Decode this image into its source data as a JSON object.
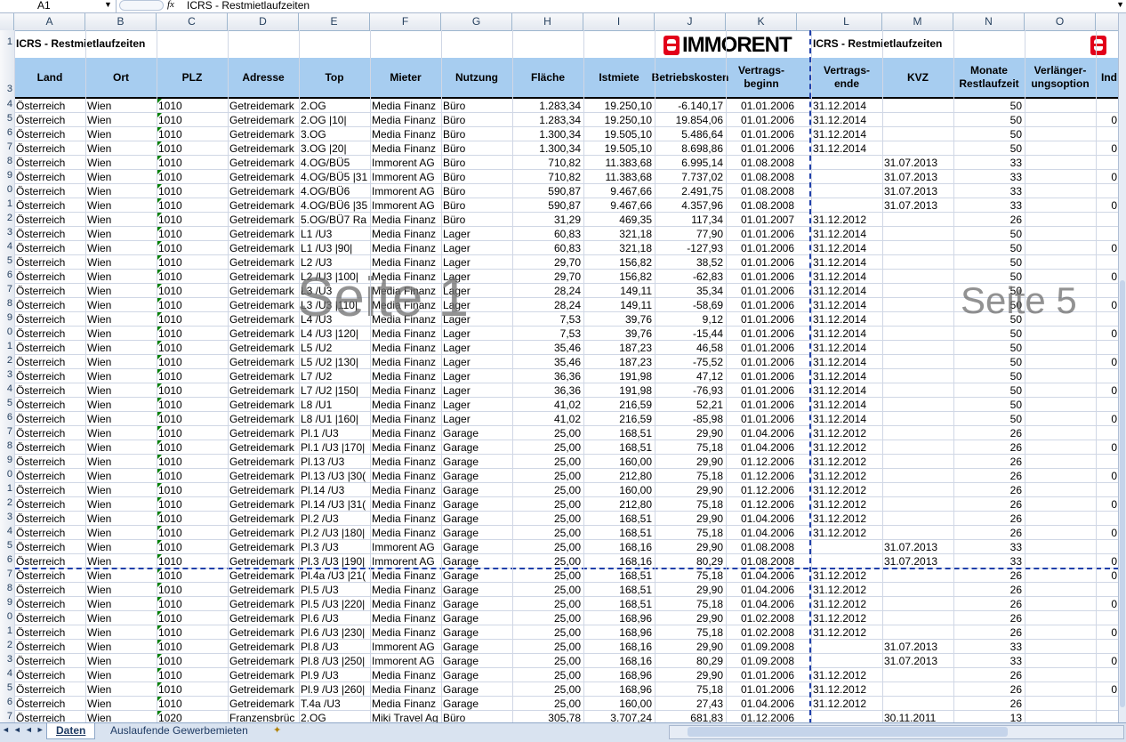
{
  "formula_bar": {
    "cell_ref": "A1",
    "fx": "fx",
    "content": "ICRS - Restmietlaufzeiten"
  },
  "columns": [
    "A",
    "B",
    "C",
    "D",
    "E",
    "F",
    "G",
    "H",
    "I",
    "J",
    "K",
    "L",
    "M",
    "N",
    "O"
  ],
  "row_numbers": [
    "1",
    "3",
    "4",
    "5",
    "6",
    "7",
    "8",
    "9",
    "0",
    "1",
    "2",
    "3",
    "4",
    "5",
    "6",
    "7",
    "8",
    "9",
    "0",
    "1",
    "2",
    "3",
    "4",
    "5",
    "6",
    "7",
    "8",
    "9",
    "0",
    "1",
    "2",
    "3",
    "4",
    "5",
    "6",
    "7",
    "8",
    "9",
    "0",
    "1",
    "2",
    "3",
    "4",
    "5",
    "6",
    "7"
  ],
  "title": "ICRS - Restmietlaufzeiten",
  "title2": "ICRS - Restmietlaufzeiten",
  "logo_text": "IMMORENT",
  "headers": {
    "land": "Land",
    "ort": "Ort",
    "plz": "PLZ",
    "adresse": "Adresse",
    "top": "Top",
    "mieter": "Mieter",
    "nutzung": "Nutzung",
    "flaeche": "Fläche",
    "istmiete": "Istmiete",
    "betriebskosten": "Betriebskosten",
    "vertragsbeginn": "Vertrags-\nbeginn",
    "vertragsende": "Vertrags-\nende",
    "kvz": "KVZ",
    "restlaufzeit": "Monate\nRestlaufzeit",
    "verlaengerung": "Verlänger-\nungsoption",
    "ind": "Ind"
  },
  "rows": [
    [
      "Österreich",
      "Wien",
      "1010",
      "Getreidemark",
      "2.OG",
      "Media Finanz",
      "Büro",
      "1.283,34",
      "19.250,10",
      "-6.140,17",
      "01.01.2006",
      "31.12.2014",
      "",
      "50",
      ""
    ],
    [
      "Österreich",
      "Wien",
      "1010",
      "Getreidemark",
      "2.OG |10|",
      "Media Finanz",
      "Büro",
      "1.283,34",
      "19.250,10",
      "19.854,06",
      "01.01.2006",
      "31.12.2014",
      "",
      "50",
      "0"
    ],
    [
      "Österreich",
      "Wien",
      "1010",
      "Getreidemark",
      "3.OG",
      "Media Finanz",
      "Büro",
      "1.300,34",
      "19.505,10",
      "5.486,64",
      "01.01.2006",
      "31.12.2014",
      "",
      "50",
      ""
    ],
    [
      "Österreich",
      "Wien",
      "1010",
      "Getreidemark",
      "3.OG |20|",
      "Media Finanz",
      "Büro",
      "1.300,34",
      "19.505,10",
      "8.698,86",
      "01.01.2006",
      "31.12.2014",
      "",
      "50",
      "0"
    ],
    [
      "Österreich",
      "Wien",
      "1010",
      "Getreidemark",
      "4.OG/BÜ5",
      "Immorent AG",
      "Büro",
      "710,82",
      "11.383,68",
      "6.995,14",
      "01.08.2008",
      "",
      "31.07.2013",
      "33",
      ""
    ],
    [
      "Österreich",
      "Wien",
      "1010",
      "Getreidemark",
      "4.OG/BÜ5 |31",
      "Immorent AG",
      "Büro",
      "710,82",
      "11.383,68",
      "7.737,02",
      "01.08.2008",
      "",
      "31.07.2013",
      "33",
      "0"
    ],
    [
      "Österreich",
      "Wien",
      "1010",
      "Getreidemark",
      "4.OG/BÜ6",
      "Immorent AG",
      "Büro",
      "590,87",
      "9.467,66",
      "2.491,75",
      "01.08.2008",
      "",
      "31.07.2013",
      "33",
      ""
    ],
    [
      "Österreich",
      "Wien",
      "1010",
      "Getreidemark",
      "4.OG/BÜ6 |35",
      "Immorent AG",
      "Büro",
      "590,87",
      "9.467,66",
      "4.357,96",
      "01.08.2008",
      "",
      "31.07.2013",
      "33",
      "0"
    ],
    [
      "Österreich",
      "Wien",
      "1010",
      "Getreidemark",
      "5.OG/BÜ7 Ra",
      "Media Finanz",
      "Büro",
      "31,29",
      "469,35",
      "117,34",
      "01.01.2007",
      "31.12.2012",
      "",
      "26",
      ""
    ],
    [
      "Österreich",
      "Wien",
      "1010",
      "Getreidemark",
      "L1 /U3",
      "Media Finanz",
      "Lager",
      "60,83",
      "321,18",
      "77,90",
      "01.01.2006",
      "31.12.2014",
      "",
      "50",
      ""
    ],
    [
      "Österreich",
      "Wien",
      "1010",
      "Getreidemark",
      "L1 /U3 |90|",
      "Media Finanz",
      "Lager",
      "60,83",
      "321,18",
      "-127,93",
      "01.01.2006",
      "31.12.2014",
      "",
      "50",
      "0"
    ],
    [
      "Österreich",
      "Wien",
      "1010",
      "Getreidemark",
      "L2 /U3",
      "Media Finanz",
      "Lager",
      "29,70",
      "156,82",
      "38,52",
      "01.01.2006",
      "31.12.2014",
      "",
      "50",
      ""
    ],
    [
      "Österreich",
      "Wien",
      "1010",
      "Getreidemark",
      "L2 /U3 |100|",
      "Media Finanz",
      "Lager",
      "29,70",
      "156,82",
      "-62,83",
      "01.01.2006",
      "31.12.2014",
      "",
      "50",
      "0"
    ],
    [
      "Österreich",
      "Wien",
      "1010",
      "Getreidemark",
      "L3 /U3",
      "Media Finanz",
      "Lager",
      "28,24",
      "149,11",
      "35,34",
      "01.01.2006",
      "31.12.2014",
      "",
      "50",
      ""
    ],
    [
      "Österreich",
      "Wien",
      "1010",
      "Getreidemark",
      "L3 /U3 |110|",
      "Media Finanz",
      "Lager",
      "28,24",
      "149,11",
      "-58,69",
      "01.01.2006",
      "31.12.2014",
      "",
      "50",
      "0"
    ],
    [
      "Österreich",
      "Wien",
      "1010",
      "Getreidemark",
      "L4 /U3",
      "Media Finanz",
      "Lager",
      "7,53",
      "39,76",
      "9,12",
      "01.01.2006",
      "31.12.2014",
      "",
      "50",
      ""
    ],
    [
      "Österreich",
      "Wien",
      "1010",
      "Getreidemark",
      "L4 /U3 |120|",
      "Media Finanz",
      "Lager",
      "7,53",
      "39,76",
      "-15,44",
      "01.01.2006",
      "31.12.2014",
      "",
      "50",
      "0"
    ],
    [
      "Österreich",
      "Wien",
      "1010",
      "Getreidemark",
      "L5 /U2",
      "Media Finanz",
      "Lager",
      "35,46",
      "187,23",
      "46,58",
      "01.01.2006",
      "31.12.2014",
      "",
      "50",
      ""
    ],
    [
      "Österreich",
      "Wien",
      "1010",
      "Getreidemark",
      "L5 /U2 |130|",
      "Media Finanz",
      "Lager",
      "35,46",
      "187,23",
      "-75,52",
      "01.01.2006",
      "31.12.2014",
      "",
      "50",
      "0"
    ],
    [
      "Österreich",
      "Wien",
      "1010",
      "Getreidemark",
      "L7 /U2",
      "Media Finanz",
      "Lager",
      "36,36",
      "191,98",
      "47,12",
      "01.01.2006",
      "31.12.2014",
      "",
      "50",
      ""
    ],
    [
      "Österreich",
      "Wien",
      "1010",
      "Getreidemark",
      "L7 /U2 |150|",
      "Media Finanz",
      "Lager",
      "36,36",
      "191,98",
      "-76,93",
      "01.01.2006",
      "31.12.2014",
      "",
      "50",
      "0"
    ],
    [
      "Österreich",
      "Wien",
      "1010",
      "Getreidemark",
      "L8 /U1",
      "Media Finanz",
      "Lager",
      "41,02",
      "216,59",
      "52,21",
      "01.01.2006",
      "31.12.2014",
      "",
      "50",
      ""
    ],
    [
      "Österreich",
      "Wien",
      "1010",
      "Getreidemark",
      "L8 /U1 |160|",
      "Media Finanz",
      "Lager",
      "41,02",
      "216,59",
      "-85,98",
      "01.01.2006",
      "31.12.2014",
      "",
      "50",
      "0"
    ],
    [
      "Österreich",
      "Wien",
      "1010",
      "Getreidemark",
      "Pl.1 /U3",
      "Media Finanz",
      "Garage",
      "25,00",
      "168,51",
      "29,90",
      "01.04.2006",
      "31.12.2012",
      "",
      "26",
      ""
    ],
    [
      "Österreich",
      "Wien",
      "1010",
      "Getreidemark",
      "Pl.1 /U3 |170|",
      "Media Finanz",
      "Garage",
      "25,00",
      "168,51",
      "75,18",
      "01.04.2006",
      "31.12.2012",
      "",
      "26",
      "0"
    ],
    [
      "Österreich",
      "Wien",
      "1010",
      "Getreidemark",
      "Pl.13 /U3",
      "Media Finanz",
      "Garage",
      "25,00",
      "160,00",
      "29,90",
      "01.12.2006",
      "31.12.2012",
      "",
      "26",
      ""
    ],
    [
      "Österreich",
      "Wien",
      "1010",
      "Getreidemark",
      "Pl.13 /U3 |30(",
      "Media Finanz",
      "Garage",
      "25,00",
      "212,80",
      "75,18",
      "01.12.2006",
      "31.12.2012",
      "",
      "26",
      "0"
    ],
    [
      "Österreich",
      "Wien",
      "1010",
      "Getreidemark",
      "Pl.14 /U3",
      "Media Finanz",
      "Garage",
      "25,00",
      "160,00",
      "29,90",
      "01.12.2006",
      "31.12.2012",
      "",
      "26",
      ""
    ],
    [
      "Österreich",
      "Wien",
      "1010",
      "Getreidemark",
      "Pl.14 /U3 |31(",
      "Media Finanz",
      "Garage",
      "25,00",
      "212,80",
      "75,18",
      "01.12.2006",
      "31.12.2012",
      "",
      "26",
      "0"
    ],
    [
      "Österreich",
      "Wien",
      "1010",
      "Getreidemark",
      "Pl.2 /U3",
      "Media Finanz",
      "Garage",
      "25,00",
      "168,51",
      "29,90",
      "01.04.2006",
      "31.12.2012",
      "",
      "26",
      ""
    ],
    [
      "Österreich",
      "Wien",
      "1010",
      "Getreidemark",
      "Pl.2 /U3 |180|",
      "Media Finanz",
      "Garage",
      "25,00",
      "168,51",
      "75,18",
      "01.04.2006",
      "31.12.2012",
      "",
      "26",
      "0"
    ],
    [
      "Österreich",
      "Wien",
      "1010",
      "Getreidemark",
      "Pl.3 /U3",
      "Immorent AG",
      "Garage",
      "25,00",
      "168,16",
      "29,90",
      "01.08.2008",
      "",
      "31.07.2013",
      "33",
      ""
    ],
    [
      "Österreich",
      "Wien",
      "1010",
      "Getreidemark",
      "Pl.3 /U3 |190|",
      "Immorent AG",
      "Garage",
      "25,00",
      "168,16",
      "80,29",
      "01.08.2008",
      "",
      "31.07.2013",
      "33",
      "0"
    ],
    [
      "Österreich",
      "Wien",
      "1010",
      "Getreidemark",
      "Pl.4a /U3 |21(",
      "Media Finanz",
      "Garage",
      "25,00",
      "168,51",
      "75,18",
      "01.04.2006",
      "31.12.2012",
      "",
      "26",
      "0"
    ],
    [
      "Österreich",
      "Wien",
      "1010",
      "Getreidemark",
      "Pl.5 /U3",
      "Media Finanz",
      "Garage",
      "25,00",
      "168,51",
      "29,90",
      "01.04.2006",
      "31.12.2012",
      "",
      "26",
      ""
    ],
    [
      "Österreich",
      "Wien",
      "1010",
      "Getreidemark",
      "Pl.5 /U3 |220|",
      "Media Finanz",
      "Garage",
      "25,00",
      "168,51",
      "75,18",
      "01.04.2006",
      "31.12.2012",
      "",
      "26",
      "0"
    ],
    [
      "Österreich",
      "Wien",
      "1010",
      "Getreidemark",
      "Pl.6 /U3",
      "Media Finanz",
      "Garage",
      "25,00",
      "168,96",
      "29,90",
      "01.02.2008",
      "31.12.2012",
      "",
      "26",
      ""
    ],
    [
      "Österreich",
      "Wien",
      "1010",
      "Getreidemark",
      "Pl.6 /U3 |230|",
      "Media Finanz",
      "Garage",
      "25,00",
      "168,96",
      "75,18",
      "01.02.2008",
      "31.12.2012",
      "",
      "26",
      "0"
    ],
    [
      "Österreich",
      "Wien",
      "1010",
      "Getreidemark",
      "Pl.8 /U3",
      "Immorent AG",
      "Garage",
      "25,00",
      "168,16",
      "29,90",
      "01.09.2008",
      "",
      "31.07.2013",
      "33",
      ""
    ],
    [
      "Österreich",
      "Wien",
      "1010",
      "Getreidemark",
      "Pl.8 /U3 |250|",
      "Immorent AG",
      "Garage",
      "25,00",
      "168,16",
      "80,29",
      "01.09.2008",
      "",
      "31.07.2013",
      "33",
      "0"
    ],
    [
      "Österreich",
      "Wien",
      "1010",
      "Getreidemark",
      "Pl.9 /U3",
      "Media Finanz",
      "Garage",
      "25,00",
      "168,96",
      "29,90",
      "01.01.2006",
      "31.12.2012",
      "",
      "26",
      ""
    ],
    [
      "Österreich",
      "Wien",
      "1010",
      "Getreidemark",
      "Pl.9 /U3 |260|",
      "Media Finanz",
      "Garage",
      "25,00",
      "168,96",
      "75,18",
      "01.01.2006",
      "31.12.2012",
      "",
      "26",
      "0"
    ],
    [
      "Österreich",
      "Wien",
      "1010",
      "Getreidemark",
      "T.4a /U3",
      "Media Finanz",
      "Garage",
      "25,00",
      "160,00",
      "27,43",
      "01.04.2006",
      "31.12.2012",
      "",
      "26",
      ""
    ],
    [
      "Österreich",
      "Wien",
      "1020",
      "Franzensbrüc",
      "2.OG",
      "Miki Travel Ag",
      "Büro",
      "305,78",
      "3.707,24",
      "681,83",
      "01.12.2006",
      "",
      "30.11.2011",
      "13",
      ""
    ]
  ],
  "watermarks": {
    "page1": "Seite 1",
    "page5": "Seite 5"
  },
  "sheet_tabs": [
    "Daten",
    "Auslaufende Gewerbemieten"
  ],
  "active_tab": "Daten",
  "colors": {
    "header_fill": "#a7cdf0",
    "page_break": "#1f3faa",
    "logo_red": "#e2001a"
  }
}
